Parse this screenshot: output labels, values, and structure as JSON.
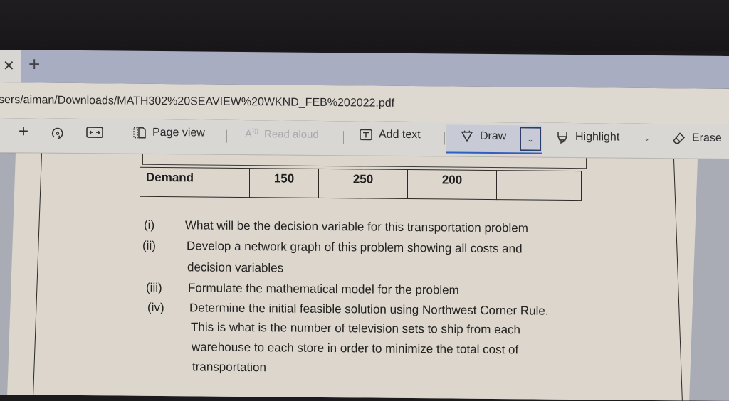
{
  "browser": {
    "tab_close_icon": "close-icon",
    "new_tab_icon": "plus-icon",
    "url": "sers/aiman/Downloads/MATH302%20SEAVIEW%20WKND_FEB%202022.pdf"
  },
  "toolbar": {
    "add_icon": "plus-icon",
    "rotate_icon": "rotate-icon",
    "fit_icon": "fit-width-icon",
    "page_view": {
      "icon": "page-view-icon",
      "label": "Page view"
    },
    "read_aloud": {
      "icon": "read-aloud-icon",
      "label": "Read aloud",
      "enabled": false
    },
    "add_text": {
      "icon": "text-box-icon",
      "label": "Add text"
    },
    "draw": {
      "icon": "pen-icon",
      "label": "Draw",
      "active": true,
      "dropdown": "chevron-down-icon"
    },
    "highlight": {
      "icon": "highlighter-icon",
      "label": "Highlight",
      "dropdown": "chevron-down-icon"
    },
    "erase": {
      "icon": "eraser-icon",
      "label": "Erase"
    },
    "accent_color": "#2f5fc0"
  },
  "document": {
    "demand_table": {
      "row_label": "Demand",
      "values": [
        "150",
        "250",
        "200",
        ""
      ]
    },
    "questions": [
      {
        "num": "(i)",
        "lines": [
          "What will be the decision variable for this transportation problem"
        ]
      },
      {
        "num": "(ii)",
        "lines": [
          "Develop a network graph of this problem showing all costs and",
          "decision variables"
        ]
      },
      {
        "num": "(iii)",
        "lines": [
          "Formulate the mathematical model for the problem"
        ]
      },
      {
        "num": "(iv)",
        "lines": [
          "Determine the initial feasible solution using Northwest Corner Rule.",
          "This is what is the number of television sets to ship from each",
          "warehouse to each store in order to minimize the total cost of",
          "transportation"
        ]
      }
    ]
  }
}
